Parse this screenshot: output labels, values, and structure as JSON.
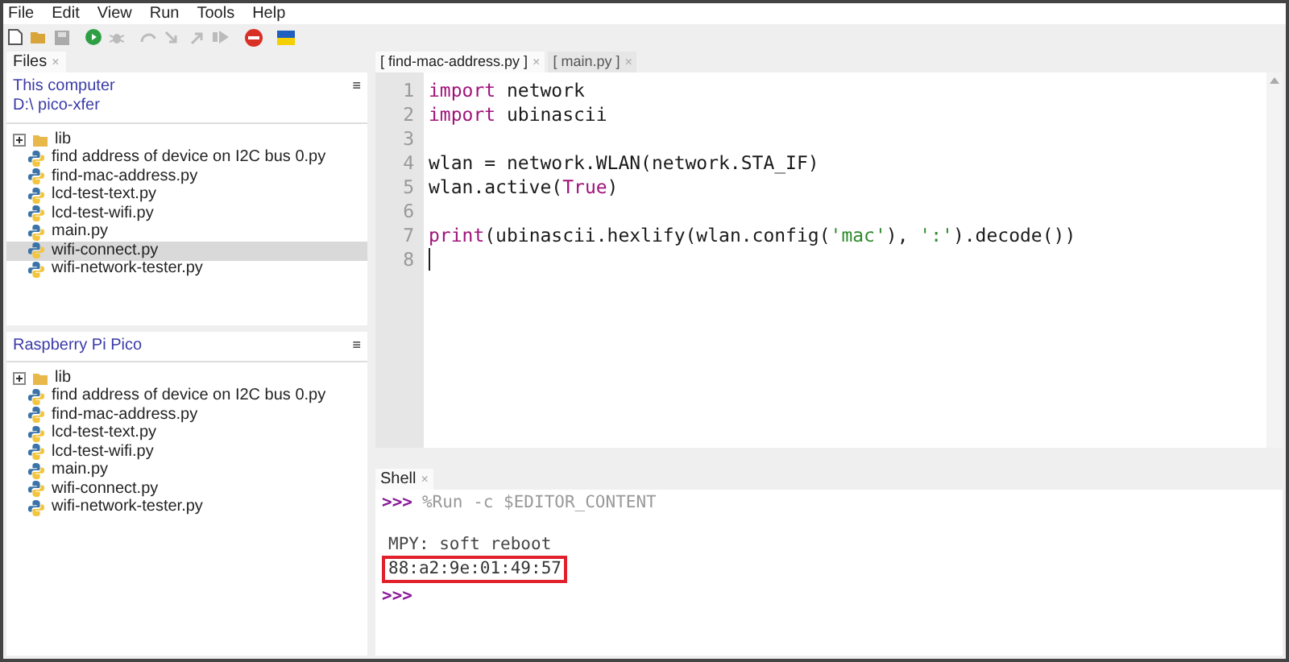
{
  "menu": [
    "File",
    "Edit",
    "View",
    "Run",
    "Tools",
    "Help"
  ],
  "files_panel": {
    "tab": "Files",
    "close": "×",
    "location": "This computer",
    "path": "D:\\ pico-xfer",
    "menu_glyph": "≡",
    "items": [
      {
        "kind": "folder",
        "name": "lib",
        "selected": false
      },
      {
        "kind": "python",
        "name": "find address of device on I2C bus 0.py",
        "selected": false
      },
      {
        "kind": "python",
        "name": "find-mac-address.py",
        "selected": false
      },
      {
        "kind": "python",
        "name": "lcd-test-text.py",
        "selected": false
      },
      {
        "kind": "python",
        "name": "lcd-test-wifi.py",
        "selected": false
      },
      {
        "kind": "python",
        "name": "main.py",
        "selected": false
      },
      {
        "kind": "python",
        "name": "wifi-connect.py",
        "selected": true
      },
      {
        "kind": "python",
        "name": "wifi-network-tester.py",
        "selected": false
      }
    ]
  },
  "device_panel": {
    "location": "Raspberry Pi Pico",
    "menu_glyph": "≡",
    "items": [
      {
        "kind": "folder",
        "name": "lib",
        "selected": false
      },
      {
        "kind": "python",
        "name": "find address of device on I2C bus 0.py",
        "selected": false
      },
      {
        "kind": "python",
        "name": "find-mac-address.py",
        "selected": false
      },
      {
        "kind": "python",
        "name": "lcd-test-text.py",
        "selected": false
      },
      {
        "kind": "python",
        "name": "lcd-test-wifi.py",
        "selected": false
      },
      {
        "kind": "python",
        "name": "main.py",
        "selected": false
      },
      {
        "kind": "python",
        "name": "wifi-connect.py",
        "selected": false
      },
      {
        "kind": "python",
        "name": "wifi-network-tester.py",
        "selected": false
      }
    ]
  },
  "editor": {
    "tabs": [
      {
        "label": "[ find-mac-address.py ]",
        "close": "×",
        "selected": true
      },
      {
        "label": "[ main.py ]",
        "close": "×",
        "selected": false
      }
    ],
    "lines": [
      {
        "number": "1",
        "tokens": [
          {
            "kind": "keyword",
            "text": "import"
          },
          {
            "kind": "plain",
            "text": " network"
          }
        ]
      },
      {
        "number": "2",
        "tokens": [
          {
            "kind": "keyword",
            "text": "import"
          },
          {
            "kind": "plain",
            "text": " ubinascii"
          }
        ]
      },
      {
        "number": "3"
      },
      {
        "number": "4",
        "tokens": [
          {
            "kind": "plain",
            "text": "wlan = network.WLAN(network.STA_IF)"
          }
        ]
      },
      {
        "number": "5",
        "tokens": [
          {
            "kind": "plain",
            "text": "wlan.active("
          },
          {
            "kind": "keyword",
            "text": "True"
          },
          {
            "kind": "plain",
            "text": ")"
          }
        ]
      },
      {
        "number": "6"
      },
      {
        "number": "7",
        "tokens": [
          {
            "kind": "keyword",
            "text": "print"
          },
          {
            "kind": "plain",
            "text": "(ubinascii.hexlify(wlan.config("
          },
          {
            "kind": "string",
            "text": "'mac'"
          },
          {
            "kind": "plain",
            "text": "), "
          },
          {
            "kind": "string",
            "text": "':'"
          },
          {
            "kind": "plain",
            "text": ").decode())"
          }
        ]
      },
      {
        "number": "8"
      }
    ]
  },
  "shell": {
    "tab": "Shell",
    "close": "×",
    "lines": [
      {
        "kind": "command",
        "prompt": ">>>",
        "text": "%Run -c $EDITOR_CONTENT"
      },
      {
        "kind": "blank"
      },
      {
        "kind": "output",
        "text": "MPY: soft reboot"
      },
      {
        "kind": "highlighted",
        "text": "88:a2:9e:01:49:57"
      },
      {
        "kind": "prompt",
        "prompt": ">>>"
      }
    ]
  }
}
